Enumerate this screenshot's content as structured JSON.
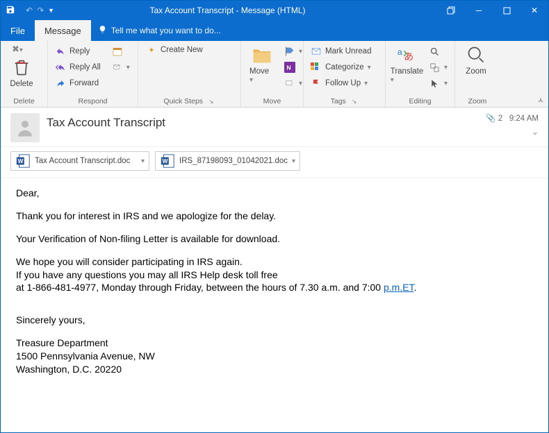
{
  "title": "Tax Account Transcript - Message (HTML)",
  "tabs": {
    "file": "File",
    "message": "Message",
    "tellme": "Tell me what you want to do..."
  },
  "ribbon": {
    "delete": {
      "btn": "Delete",
      "grp": "Delete"
    },
    "respond": {
      "reply": "Reply",
      "replyall": "Reply All",
      "forward": "Forward",
      "grp": "Respond"
    },
    "quicksteps": {
      "create": "Create New",
      "grp": "Quick Steps"
    },
    "move": {
      "btn": "Move",
      "grp": "Move"
    },
    "tags": {
      "unread": "Mark Unread",
      "categorize": "Categorize",
      "followup": "Follow Up",
      "grp": "Tags"
    },
    "editing": {
      "translate": "Translate",
      "grp": "Editing"
    },
    "zoom": {
      "btn": "Zoom",
      "grp": "Zoom"
    }
  },
  "header": {
    "subject": "Tax Account Transcript",
    "attachcount": "2",
    "time": "9:24 AM"
  },
  "attachments": [
    {
      "name": "Tax Account Transcript.doc"
    },
    {
      "name": "IRS_87198093_01042021.doc"
    }
  ],
  "body": {
    "greeting": "Dear,",
    "p1": "Thank you for interest in IRS and we apologize for the delay.",
    "p2": "Your Verification of Non-filing Letter is available for download.",
    "p3a": "We hope you will consider participating in IRS again.",
    "p3b": "If you have any questions you may all IRS Help desk toll free",
    "p3c_pre": "at 1-866-481-4977, Monday through Friday, between the hours of 7.30 a.m. and 7:00 ",
    "p3c_link": "p.m.ET",
    "signoff": "Sincerely yours,",
    "sig1": "Treasure Department",
    "sig2": "1500 Pennsylvania Avenue, NW",
    "sig3": "Washington, D.C. 20220"
  }
}
